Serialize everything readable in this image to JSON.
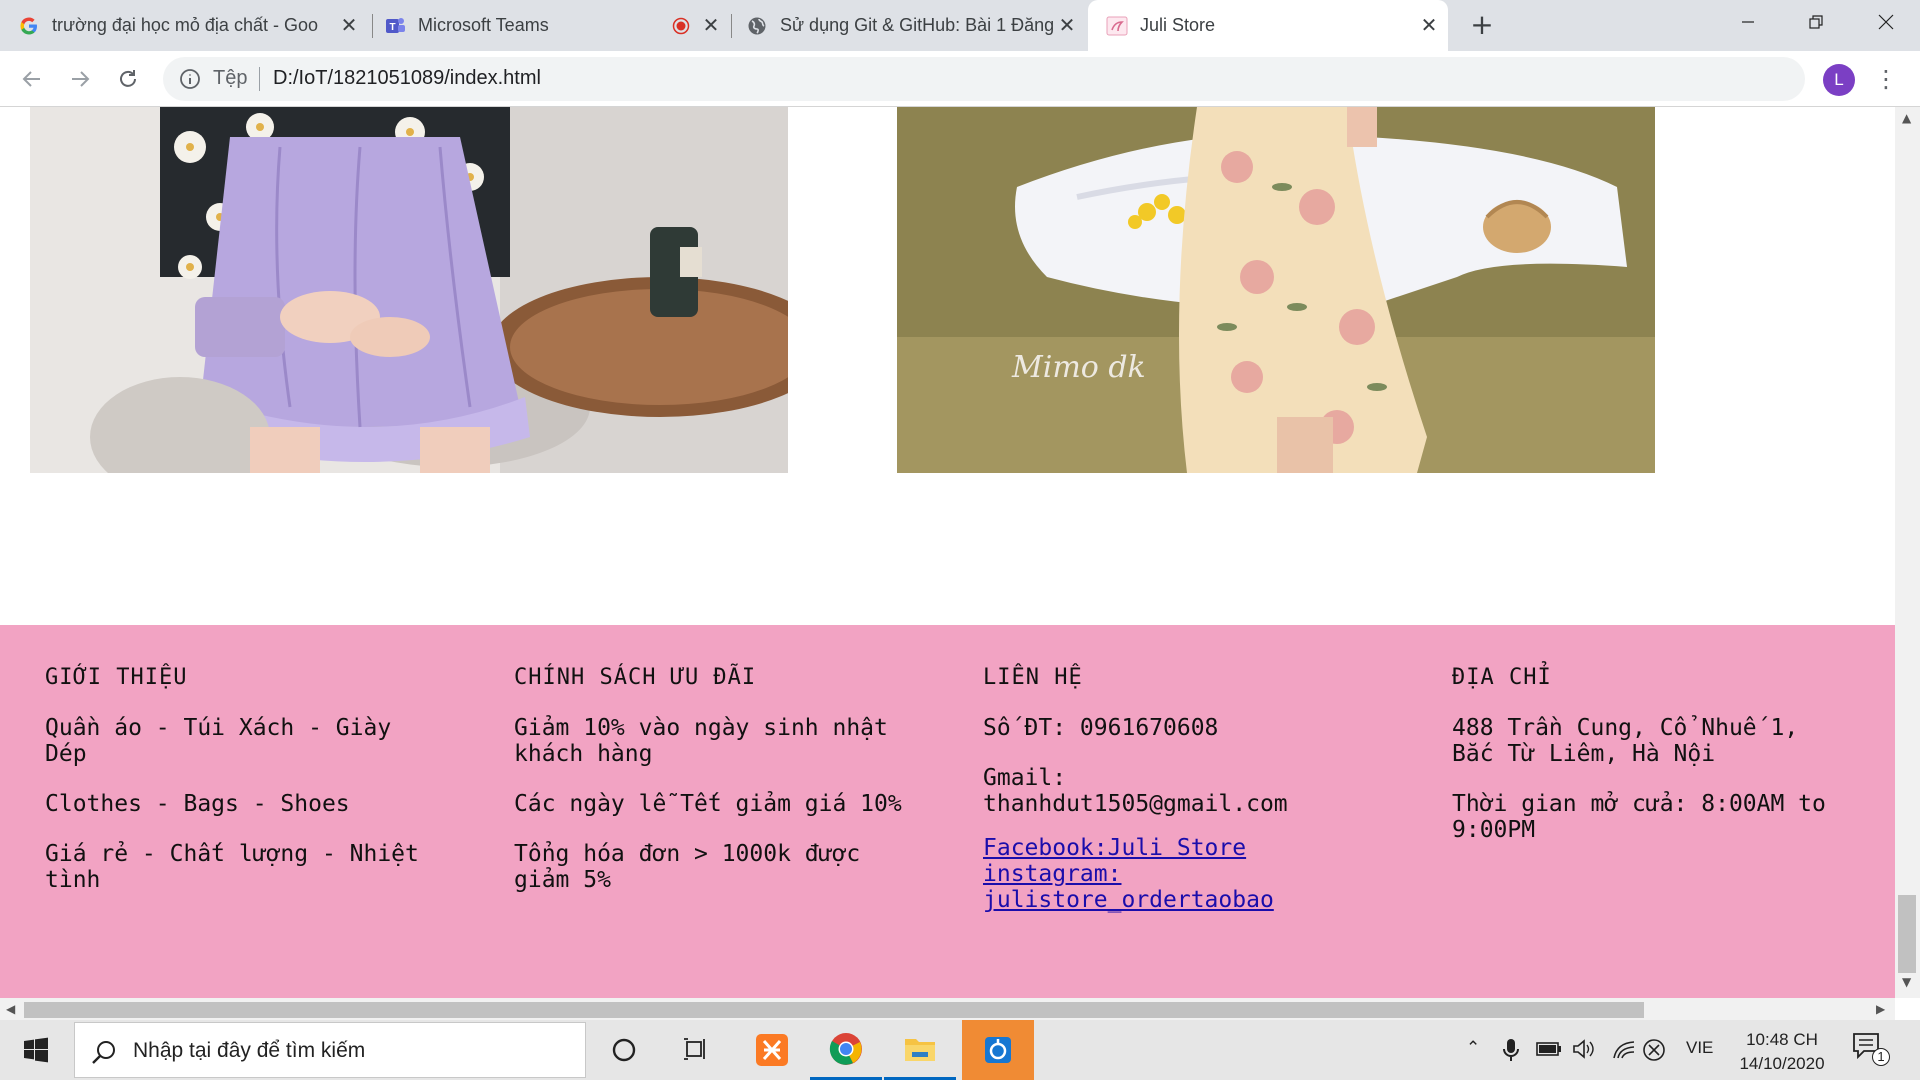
{
  "browser": {
    "tabs": [
      {
        "title": "trường đại học mỏ địa chất - Goo",
        "icon": "google-icon",
        "active": false
      },
      {
        "title": "Microsoft Teams",
        "icon": "teams-icon",
        "active": false
      },
      {
        "title": "Sử dụng Git & GitHub: Bài 1 Đăng",
        "icon": "globe-icon",
        "active": false
      },
      {
        "title": "Juli Store",
        "icon": "juli-store-favicon",
        "active": true
      }
    ],
    "new_tab": "+",
    "window_controls": {
      "minimize": "—",
      "restore": "❐",
      "close": "✕"
    },
    "address": {
      "scheme_label": "Tệp",
      "url": "D:/IoT/1821051089/index.html"
    },
    "profile_initial": "L",
    "menu": "⋮"
  },
  "page": {
    "footer": {
      "columns": [
        {
          "heading": "GIỚI THIỆU",
          "lines": [
            "Quần áo - Túi Xách - Giày Dép",
            "Clothes - Bags - Shoes",
            "Giá rẻ - Chất lượng - Nhiệt tình"
          ]
        },
        {
          "heading": "CHÍNH SÁCH ƯU ĐÃI",
          "lines": [
            "Giảm 10% vào ngày sinh nhật khách hàng",
            "Các ngày lễ Tết giảm giá 10%",
            "Tổng hóa đơn > 1000k được giảm 5%"
          ]
        },
        {
          "heading": "LIÊN HỆ",
          "lines": [
            "Số ĐT: 0961670608",
            "Gmail: thanhdut1505@gmail.com"
          ],
          "links": [
            "Facebook:Juli Store",
            "instagram: julistore_ordertaobao"
          ]
        },
        {
          "heading": "ĐỊA CHỈ",
          "lines": [
            "488 Trần Cung, Cổ Nhuế 1, Bắc Từ Liêm, Hà Nội",
            "Thời gian mở cửa: 8:00AM to 9:00PM"
          ]
        }
      ]
    },
    "images": [
      {
        "watermark": ""
      },
      {
        "watermark": "Mimo dk"
      }
    ]
  },
  "taskbar": {
    "search_placeholder": "Nhập tại đây để tìm kiếm",
    "pinned": [
      "cortana-icon",
      "task-view-icon",
      "xampp-icon",
      "chrome-icon",
      "file-explorer-icon",
      "app-icon"
    ],
    "tray": {
      "language": "VIE",
      "notification_count": "1"
    },
    "clock": {
      "time": "10:48 CH",
      "date": "14/10/2020"
    }
  }
}
